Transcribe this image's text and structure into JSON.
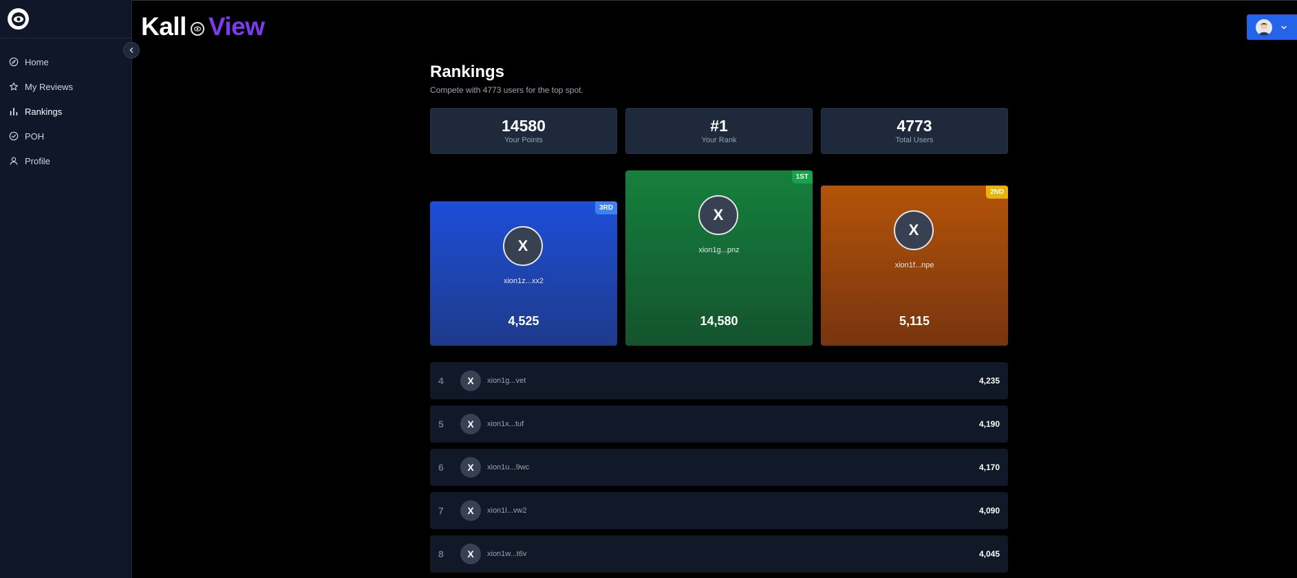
{
  "app": {
    "brand_left": "Kall",
    "brand_right": "View",
    "accent_color": "#7c3aed"
  },
  "sidebar": {
    "items": [
      {
        "label": "Home",
        "icon": "compass-icon"
      },
      {
        "label": "My Reviews",
        "icon": "star-icon"
      },
      {
        "label": "Rankings",
        "icon": "bar-chart-icon",
        "active": true
      },
      {
        "label": "POH",
        "icon": "check-circle-icon"
      },
      {
        "label": "Profile",
        "icon": "user-icon"
      }
    ]
  },
  "page": {
    "title": "Rankings",
    "subtitle": "Compete with 4773 users for the top spot."
  },
  "stats": [
    {
      "value": "14580",
      "label": "Your Points"
    },
    {
      "value": "#1",
      "label": "Your Rank"
    },
    {
      "value": "4773",
      "label": "Total Users"
    }
  ],
  "podium": {
    "third": {
      "badge": "3RD",
      "initial": "X",
      "name": "xion1z...xx2",
      "score": "4,525"
    },
    "first": {
      "badge": "1ST",
      "initial": "X",
      "name": "xion1g...pnz",
      "score": "14,580"
    },
    "second": {
      "badge": "2ND",
      "initial": "X",
      "name": "xion1f...npe",
      "score": "5,115"
    }
  },
  "leaderboard": [
    {
      "rank": "4",
      "initial": "X",
      "name": "xion1g...vet",
      "score": "4,235"
    },
    {
      "rank": "5",
      "initial": "X",
      "name": "xion1x...tuf",
      "score": "4,190"
    },
    {
      "rank": "6",
      "initial": "X",
      "name": "xion1u...9wc",
      "score": "4,170"
    },
    {
      "rank": "7",
      "initial": "X",
      "name": "xion1l...vw2",
      "score": "4,090"
    },
    {
      "rank": "8",
      "initial": "X",
      "name": "xion1w...t6v",
      "score": "4,045"
    }
  ]
}
